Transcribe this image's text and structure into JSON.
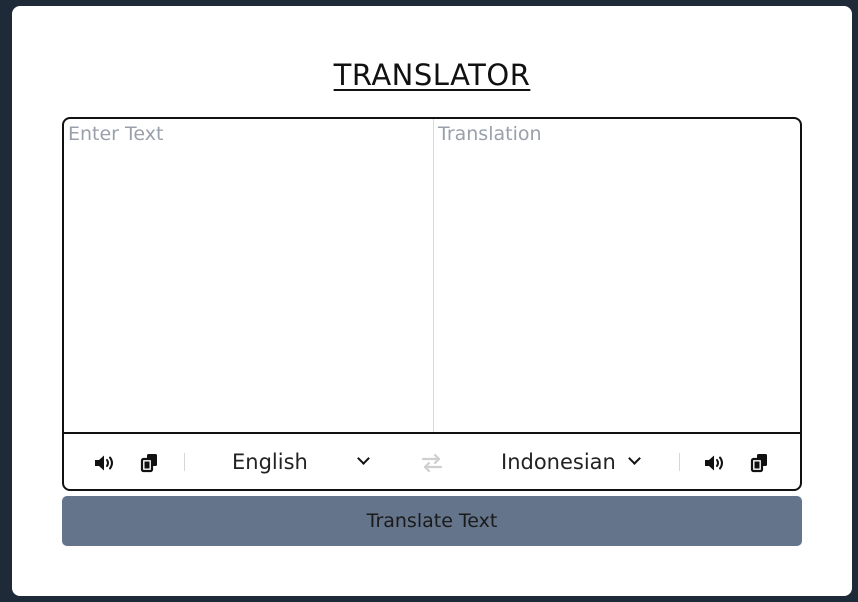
{
  "app": {
    "title": "TRANSLATOR"
  },
  "input": {
    "placeholder": "Enter Text",
    "value": ""
  },
  "output": {
    "placeholder": "Translation",
    "value": ""
  },
  "controls": {
    "from_language": "English",
    "to_language": "Indonesian",
    "icons": {
      "speak": "speaker-icon",
      "copy": "copy-icon",
      "swap": "swap-arrows-icon",
      "dropdown": "chevron-down-icon"
    },
    "swap_color": "#d0d0d0"
  },
  "action": {
    "translate_label": "Translate Text",
    "button_color": "#64748b"
  }
}
